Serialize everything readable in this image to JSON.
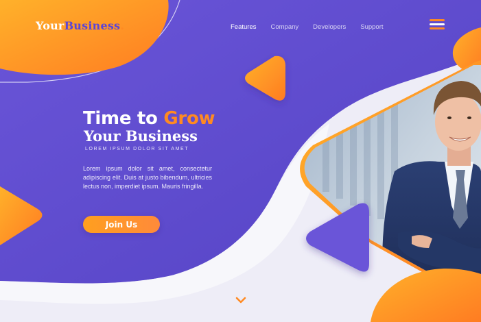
{
  "brand": {
    "prefix": "Your",
    "name": "Business",
    "dot": "."
  },
  "nav": {
    "items": [
      {
        "label": "Features",
        "active": true
      },
      {
        "label": "Company",
        "active": false
      },
      {
        "label": "Developers",
        "active": false
      },
      {
        "label": "Support",
        "active": false
      }
    ]
  },
  "menu_icon": "hamburger-menu-icon",
  "hero": {
    "headline_part1": "Time to ",
    "headline_highlight": "Grow",
    "subheadline": "Your Business",
    "tagline": "LOREM IPSUM DOLOR SIT AMET",
    "body": "Lorem ipsum dolor sit amet, consectetur adipiscing elit. Duis at justo bibendum, ultricies lectus non, imperdiet ipsum. Mauris fringilla.",
    "cta_label": "Join Us"
  },
  "scroll_icon": "chevron-down-icon",
  "colors": {
    "primary_purple": "#5e4fd0",
    "accent_orange": "#ff8a22",
    "text_white": "#ffffff",
    "page_bg": "#eceaf6"
  }
}
